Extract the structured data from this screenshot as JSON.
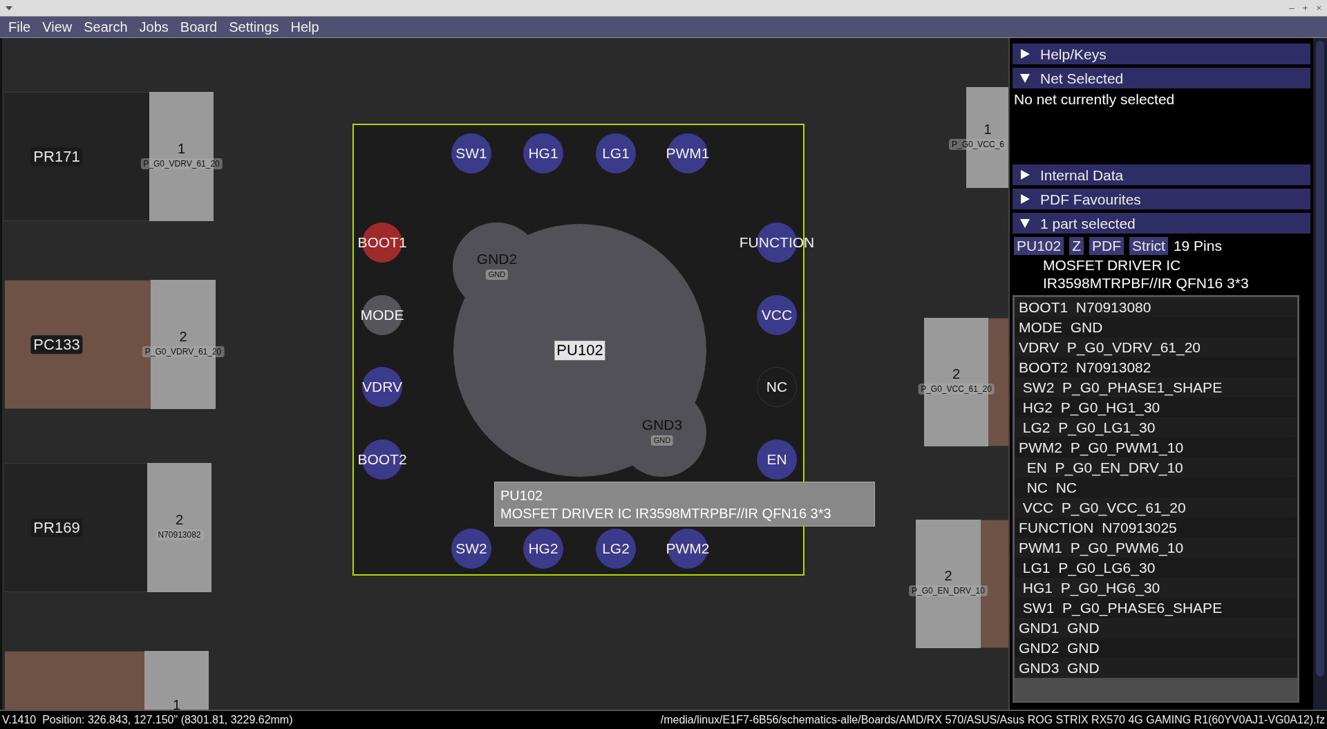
{
  "title_bar": {
    "buttons": [
      "–",
      "+",
      "×"
    ]
  },
  "menu": [
    "File",
    "View",
    "Search",
    "Jobs",
    "Board",
    "Settings",
    "Help"
  ],
  "board": {
    "parts": [
      {
        "kind": "resistor",
        "ref": "PR171",
        "pad": {
          "number": "1",
          "net": "P_G0_VDRV_61_20"
        }
      },
      {
        "kind": "capacitor",
        "ref": "PC133",
        "pad": {
          "number": "2",
          "net": "P_G0_VDRV_61_20"
        }
      },
      {
        "kind": "resistor",
        "ref": "PR169",
        "pad": {
          "number": "2",
          "net": "N70913082"
        }
      },
      {
        "kind": "capacitor",
        "pad": {
          "number": "1"
        }
      },
      {
        "pad": {
          "number": "1",
          "net": "P_G0_VCC_6"
        }
      },
      {
        "kind": "capacitor",
        "pad": {
          "number": "2",
          "net": "P_G0_VCC_61_20"
        }
      },
      {
        "kind": "capacitor",
        "pad": {
          "number": "2",
          "net": "P_G0_EN_DRV_10"
        }
      }
    ],
    "component": {
      "ref": "PU102",
      "pins": [
        {
          "name": "SW1",
          "kind": "signal",
          "selected": false
        },
        {
          "name": "HG1",
          "kind": "signal",
          "selected": false
        },
        {
          "name": "LG1",
          "kind": "signal",
          "selected": false
        },
        {
          "name": "PWM1",
          "kind": "signal",
          "selected": false
        },
        {
          "name": "BOOT1",
          "kind": "signal",
          "selected": true
        },
        {
          "name": "MODE",
          "kind": "ground",
          "selected": false
        },
        {
          "name": "VDRV",
          "kind": "signal",
          "selected": false
        },
        {
          "name": "BOOT2",
          "kind": "signal",
          "selected": false
        },
        {
          "name": "FUNCTION",
          "kind": "signal",
          "selected": false
        },
        {
          "name": "VCC",
          "kind": "signal",
          "selected": false
        },
        {
          "name": "NC",
          "kind": "nc",
          "selected": false
        },
        {
          "name": "EN",
          "kind": "signal",
          "selected": false
        },
        {
          "name": "SW2",
          "kind": "signal",
          "selected": false
        },
        {
          "name": "HG2",
          "kind": "signal",
          "selected": false
        },
        {
          "name": "LG2",
          "kind": "signal",
          "selected": false
        },
        {
          "name": "PWM2",
          "kind": "signal",
          "selected": false
        }
      ],
      "ground_pads": [
        {
          "name": "GND2",
          "net": "GND"
        },
        {
          "name": "GND3",
          "net": "GND"
        }
      ]
    },
    "tooltip": [
      "PU102",
      "MOSFET DRIVER IC IR3598MTRPBF//IR QFN16 3*3"
    ]
  },
  "panel": {
    "sections": [
      {
        "title": "Help/Keys",
        "expanded": false
      },
      {
        "title": "Net Selected",
        "expanded": true,
        "text": "No net currently selected"
      },
      {
        "title": "Internal Data",
        "expanded": false
      },
      {
        "title": "PDF Favourites",
        "expanded": false
      },
      {
        "title": "1 part selected",
        "expanded": true,
        "part": {
          "buttons": [
            "PU102",
            "Z",
            "PDF",
            "Strict"
          ],
          "pin_count": "19 Pins",
          "description": [
            "MOSFET DRIVER IC",
            "IR3598MTRPBF//IR QFN16 3*3"
          ],
          "pins": [
            "BOOT1  N70913080",
            "MODE  GND",
            "VDRV  P_G0_VDRV_61_20",
            "BOOT2  N70913082",
            " SW2  P_G0_PHASE1_SHAPE",
            " HG2  P_G0_HG1_30",
            " LG2  P_G0_LG1_30",
            "PWM2  P_G0_PWM1_10",
            "  EN  P_G0_EN_DRV_10",
            "  NC  NC",
            " VCC  P_G0_VCC_61_20",
            "FUNCTION  N70913025",
            "PWM1  P_G0_PWM6_10",
            " LG1  P_G0_LG6_30",
            " HG1  P_G0_HG6_30",
            " SW1  P_G0_PHASE6_SHAPE",
            "GND1  GND",
            "GND2  GND",
            "GND3  GND"
          ]
        }
      }
    ]
  },
  "status_bar": {
    "left": "V.1410  Position: 326.843, 127.150\" (8301.81, 3229.62mm)",
    "right": "/media/linux/E1F7-6B56/schematics-alle/Boards/AMD/RX 570/ASUS/Asus ROG STRIX RX570 4G GAMING R1(60YV0AJ1-VG0A12).fz"
  }
}
